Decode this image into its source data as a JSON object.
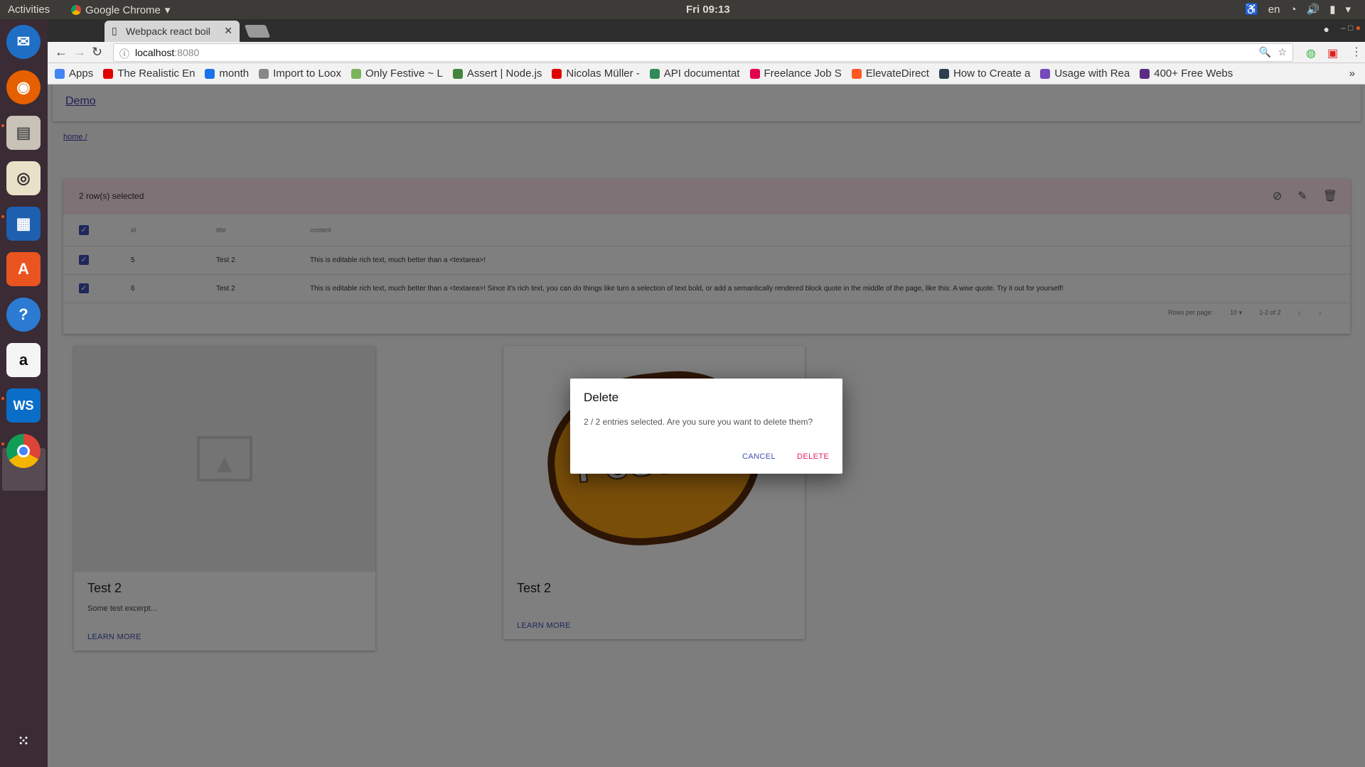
{
  "system": {
    "activities": "Activities",
    "app_name": "Google Chrome",
    "clock": "Fri 09:13",
    "lang": "en"
  },
  "browser": {
    "tab_title": "Webpack react boil",
    "url_host": "localhost",
    "url_port": ":8080",
    "bookmarks": [
      {
        "label": "Apps",
        "color": "#4285f4"
      },
      {
        "label": "The Realistic En",
        "color": "#e00000"
      },
      {
        "label": "month",
        "color": "#1a73e8"
      },
      {
        "label": "Import to Loox",
        "color": "#888888"
      },
      {
        "label": "Only Festive ~ L",
        "color": "#7ab55c"
      },
      {
        "label": "Assert | Node.js",
        "color": "#43853d"
      },
      {
        "label": "Nicolas Müller -",
        "color": "#e00000"
      },
      {
        "label": "API documentat",
        "color": "#2e8b57"
      },
      {
        "label": "Freelance Job S",
        "color": "#e4004b"
      },
      {
        "label": "ElevateDirect",
        "color": "#ff5722"
      },
      {
        "label": "How to Create a",
        "color": "#2c3e50"
      },
      {
        "label": "Usage with Rea",
        "color": "#764abc"
      },
      {
        "label": "400+ Free Webs",
        "color": "#5b2c83"
      }
    ]
  },
  "app": {
    "brand": "Demo",
    "breadcrumb": "home /",
    "table": {
      "selection_label": "2 row(s) selected",
      "columns": [
        "id",
        "title",
        "content"
      ],
      "rows": [
        {
          "id": "5",
          "title": "Test 2",
          "content": "This is editable rich text, much better than a <textarea>!"
        },
        {
          "id": "6",
          "title": "Test 2",
          "content": "This is editable rich text, much better than a <textarea>! Since it's rich text, you can do things like turn a selection of text bold, or add a semantically rendered block quote in the middle of the page, like this: A wise quote. Try it out for yourself!"
        }
      ],
      "rows_per_page_label": "Rows per page:",
      "rows_per_page": "10",
      "range": "1-2 of 2"
    },
    "cards": [
      {
        "title": "Test 2",
        "excerpt": "Some test excerpt...",
        "action": "LEARN MORE"
      },
      {
        "title": "Test 2",
        "excerpt": "",
        "action": "LEARN MORE",
        "logo_text": "Festive"
      }
    ]
  },
  "dialog": {
    "title": "Delete",
    "message": "2 / 2 entries selected. Are you sure you want to delete them?",
    "cancel": "CANCEL",
    "delete": "DELETE",
    "accent": "#e91e63",
    "primary": "#3f51b5"
  }
}
